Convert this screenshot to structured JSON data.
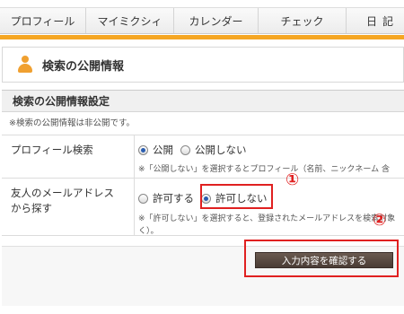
{
  "nav": {
    "items": [
      "プロフィール",
      "マイミクシィ",
      "カレンダー",
      "チェック",
      "日記"
    ]
  },
  "page": {
    "title": "検索の公開情報"
  },
  "section": {
    "header": "検索の公開情報設定",
    "note": "※検索の公開情報は非公開です。"
  },
  "profile_search": {
    "label": "プロフィール検索",
    "options": [
      "公開",
      "公開しない"
    ],
    "selected": "公開",
    "hint": "※「公開しない」を選択するとプロフィール（名前、ニックネーム 含"
  },
  "friend_email": {
    "label_line1": "友人のメールアドレス",
    "label_line2": "から探す",
    "options": [
      "許可する",
      "許可しない"
    ],
    "selected": "許可しない",
    "hint_line1": "※「許可しない」を選択すると、登録されたメールアドレスを検索対象",
    "hint_line2": "く）。"
  },
  "annotations": {
    "marker1": "①",
    "marker2": "②"
  },
  "submit": {
    "label": "入力内容を確認する"
  },
  "colors": {
    "accent": "#f5a623",
    "highlight": "#e02020",
    "button": "#4a3c35"
  }
}
